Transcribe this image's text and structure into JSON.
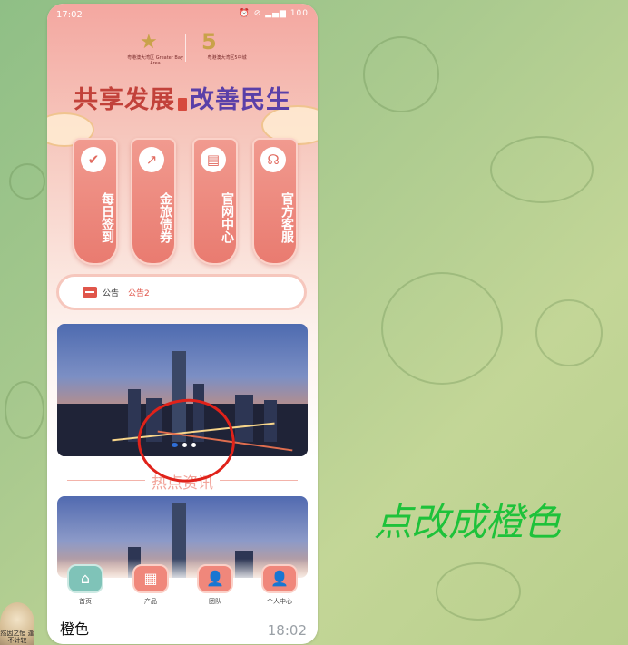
{
  "status_bar": {
    "time": "17:02",
    "icons": "⏰ ⊘ ▂▄▆ 100"
  },
  "header": {
    "logo_left_text": "粤港澳大湾区 Greater Bay Area",
    "logo_right_text": "粤港澳大湾区5中城",
    "slogan_left": "共享发展",
    "slogan_right": "改善民生"
  },
  "features": [
    {
      "label": "每日签到",
      "icon": "calendar-check-icon",
      "glyph": "✔"
    },
    {
      "label": "金旅债券",
      "icon": "chart-trend-icon",
      "glyph": "↗"
    },
    {
      "label": "官网中心",
      "icon": "building-icon",
      "glyph": "▤"
    },
    {
      "label": "官方客服",
      "icon": "headset-icon",
      "glyph": "☊"
    }
  ],
  "notice": {
    "label": "公告",
    "text": "公告2"
  },
  "carousel": {
    "slide_count": 3,
    "active_index": 0
  },
  "section": {
    "title": "热点资讯"
  },
  "bottom_nav": [
    {
      "label": "首页",
      "icon": "home-icon",
      "glyph": "⌂"
    },
    {
      "label": "产品",
      "icon": "grid-icon",
      "glyph": "▦"
    },
    {
      "label": "团队",
      "icon": "team-icon",
      "glyph": "👤"
    },
    {
      "label": "个人中心",
      "icon": "user-icon",
      "glyph": "👤"
    }
  ],
  "chat": {
    "message": "橙色",
    "time": "18:02",
    "avatar_caption": "然因之恒\n逢不计较"
  },
  "annotation": {
    "text": "点改成橙色"
  },
  "colors": {
    "annotation": "#1ec23a",
    "circle": "#e0221a",
    "pillar": "#e97b70",
    "active_dot": "#2f6fd8"
  }
}
